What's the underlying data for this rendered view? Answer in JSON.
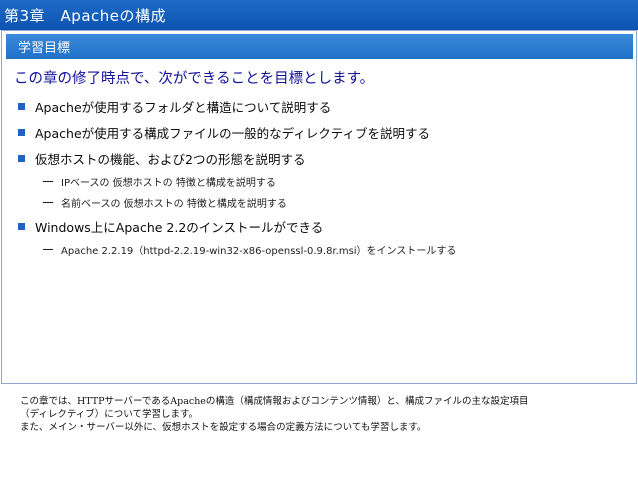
{
  "header": {
    "title": "第3章　Apacheの構成"
  },
  "section": {
    "title": "学習目標"
  },
  "lead": "この章の修了時点で、次ができることを目標とします。",
  "bullets": [
    {
      "text": "Apacheが使用するフォルダと構造について説明する",
      "subs": []
    },
    {
      "text": "Apacheが使用する構成ファイルの一般的なディレクティブを説明する",
      "subs": []
    },
    {
      "text": "仮想ホストの機能、および2つの形態を説明する",
      "subs": [
        "IPベースの 仮想ホストの 特徴と構成を説明する",
        "名前ベースの 仮想ホストの 特徴と構成を説明する"
      ]
    },
    {
      "text": "Windows上にApache 2.2のインストールができる",
      "subs": [
        "Apache 2.2.19（httpd-2.2.19-win32-x86-openssl-0.9.8r.msi）をインストールする"
      ]
    }
  ],
  "notes": [
    "この章では、HTTPサーバーであるApacheの構造（構成情報およびコンテンツ情報）と、構成ファイルの主な設定項目",
    "（ディレクティブ）について学習します。",
    "また、メイン・サーバー以外に、仮想ホストを設定する場合の定義方法についても学習します。"
  ],
  "colors": {
    "title_bar": "#0e53b2",
    "section_bar": "#1f70c8",
    "lead_text": "#10109a",
    "bullet_marker": "#1d65c2"
  }
}
